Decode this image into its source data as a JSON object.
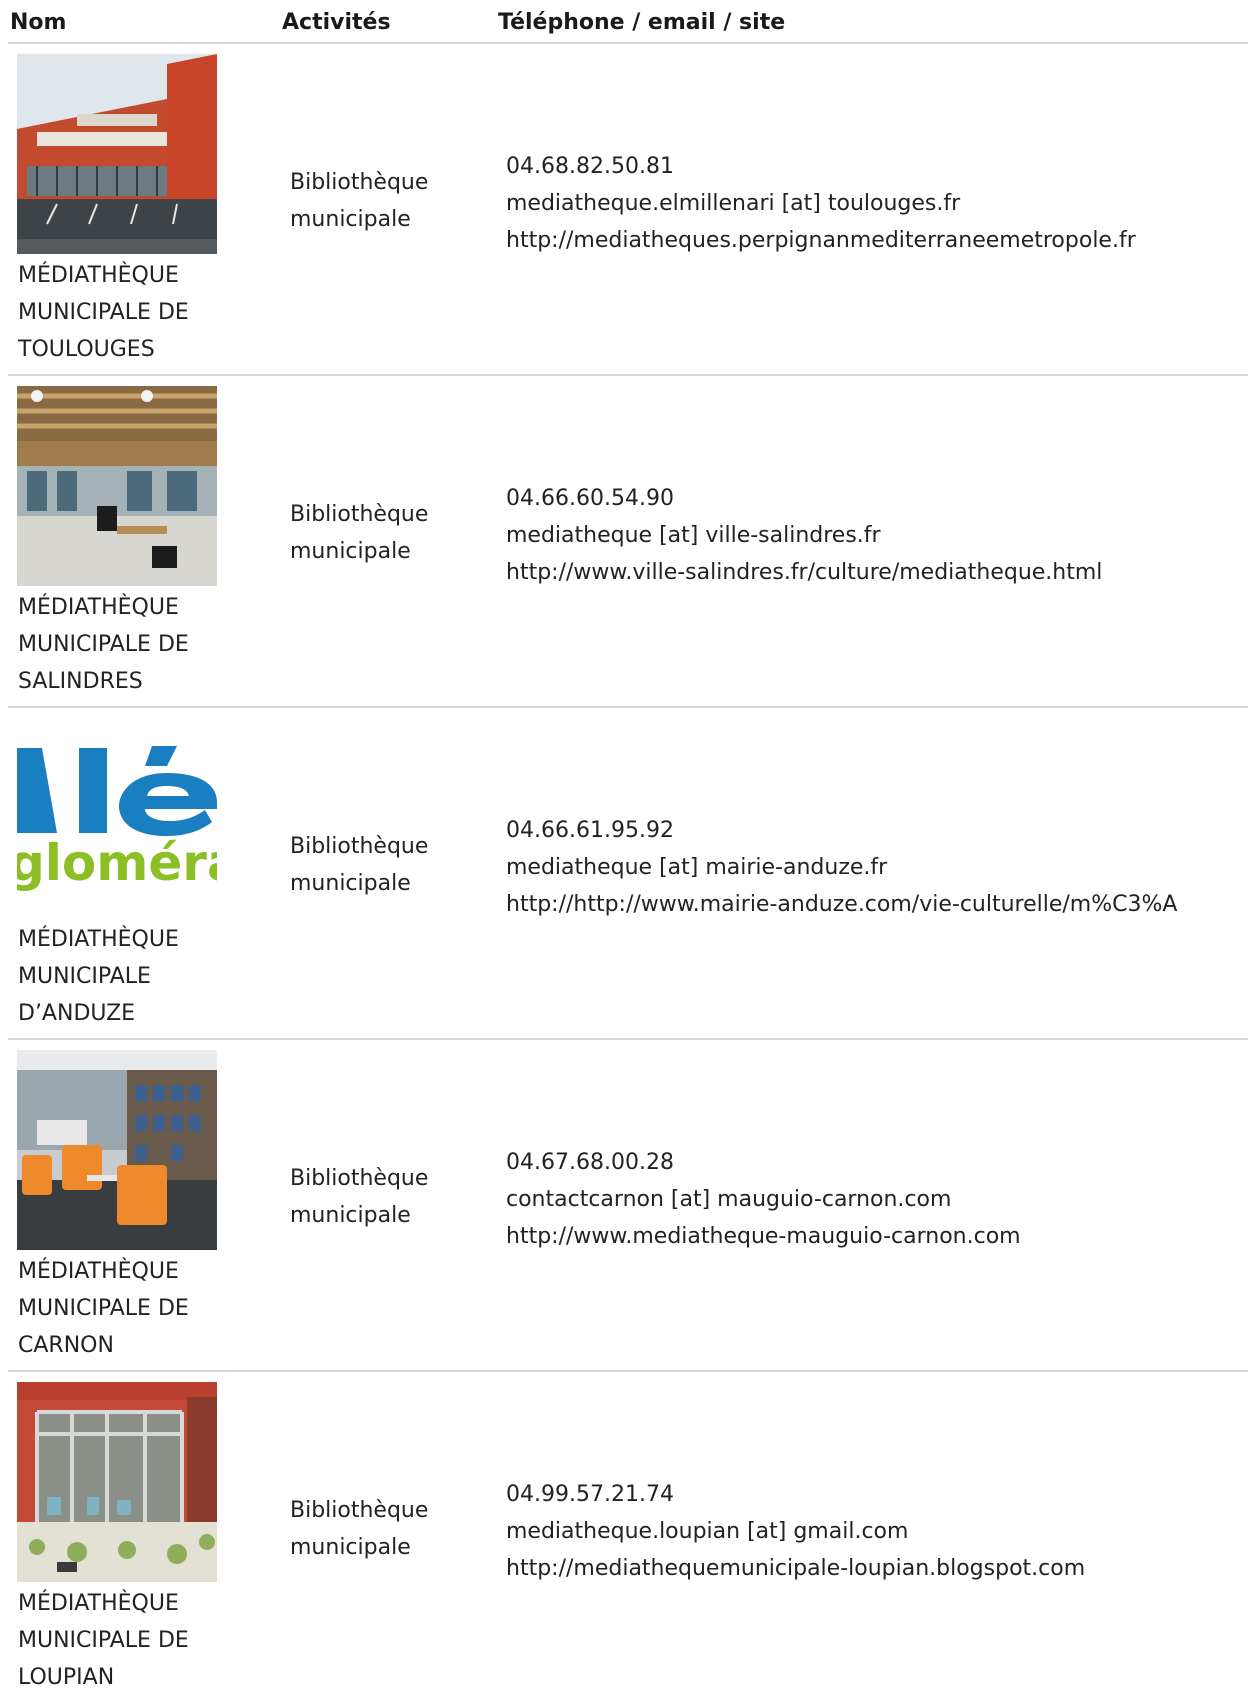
{
  "header": {
    "col_name": "Nom",
    "col_activity": "Activités",
    "col_contact": "Téléphone / email / site"
  },
  "rows": [
    {
      "name_lines": [
        "MÉDIATHÈQUE",
        "MUNICIPALE DE",
        "TOULOUGES"
      ],
      "activity_lines": [
        "Bibliothèque",
        "municipale"
      ],
      "phone": "04.68.82.50.81",
      "email": "mediatheque.elmillenari [at] toulouges.fr",
      "site": "http://mediatheques.perpignanmediterraneemetropole.fr",
      "image": "building-photo"
    },
    {
      "name_lines": [
        "MÉDIATHÈQUE",
        "MUNICIPALE DE",
        "SALINDRES"
      ],
      "activity_lines": [
        "Bibliothèque",
        "municipale"
      ],
      "phone": "04.66.60.54.90",
      "email": "mediatheque [at] ville-salindres.fr",
      "site": "http://www.ville-salindres.fr/culture/mediatheque.html",
      "image": "library-interior-photo"
    },
    {
      "name_lines": [
        "MÉDIATHÈQUE",
        "MUNICIPALE",
        "D’ANDUZE"
      ],
      "activity_lines": [
        "Bibliothèque",
        "municipale"
      ],
      "phone": "04.66.61.95.92",
      "email": "mediatheque [at] mairie-anduze.fr",
      "site": "http://http://www.mairie-anduze.com/vie-culturelle/m%C3%A",
      "image": "ales-agglomeration-logo",
      "logo_text_top": "Alè",
      "logo_text_bottom": "gloméra"
    },
    {
      "name_lines": [
        "MÉDIATHÈQUE",
        "MUNICIPALE DE",
        "CARNON"
      ],
      "activity_lines": [
        "Bibliothèque",
        "municipale"
      ],
      "phone": "04.67.68.00.28",
      "email": "contactcarnon [at] mauguio-carnon.com",
      "site": "http://www.mediatheque-mauguio-carnon.com",
      "image": "reading-room-photo"
    },
    {
      "name_lines": [
        "MÉDIATHÈQUE",
        "MUNICIPALE DE",
        "LOUPIAN"
      ],
      "activity_lines": [
        "Bibliothèque",
        "municipale"
      ],
      "phone": "04.99.57.21.74",
      "email": "mediatheque.loupian [at] gmail.com",
      "site": "http://mediathequemunicipale-loupian.blogspot.com",
      "image": "facade-photo"
    }
  ],
  "colors": {
    "border": "#d7d7d7",
    "text": "#222222",
    "logo_blue": "#1a7fc1",
    "logo_green": "#8cbf26"
  }
}
